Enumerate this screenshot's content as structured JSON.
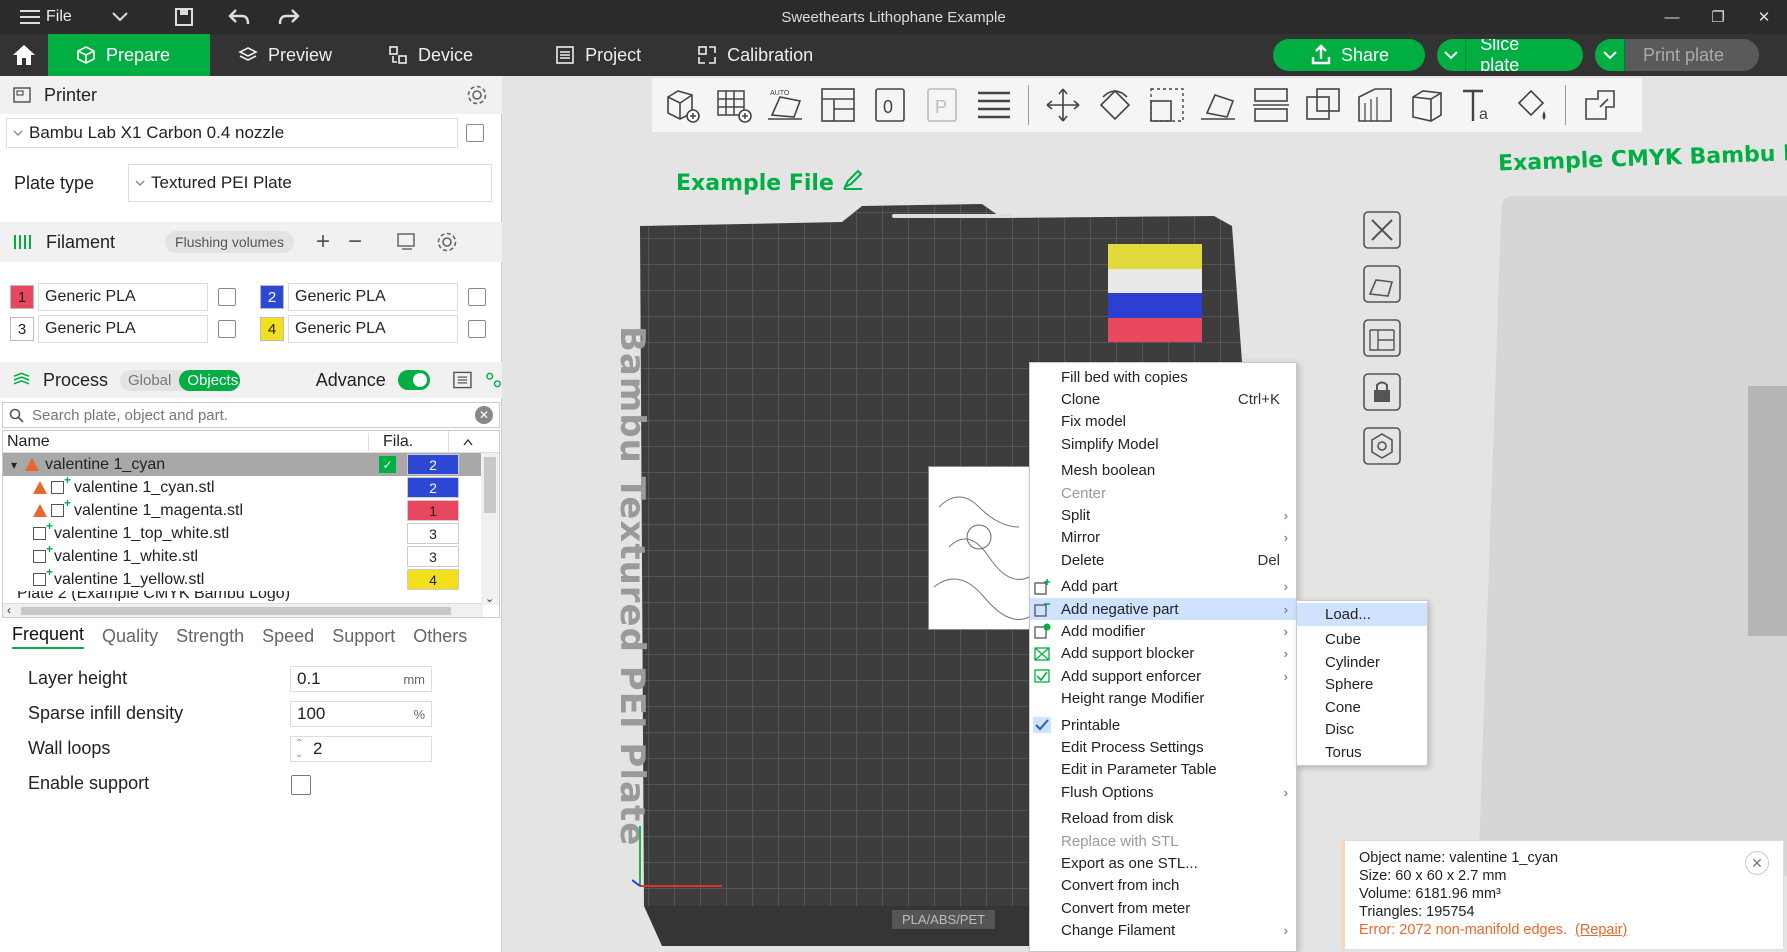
{
  "titlebar": {
    "file_label": "File",
    "window_title": "Sweethearts Lithophane Example"
  },
  "nav": {
    "tabs": [
      {
        "label": "Prepare",
        "icon": "cube-icon"
      },
      {
        "label": "Preview",
        "icon": "layers-icon"
      },
      {
        "label": "Device",
        "icon": "device-icon"
      },
      {
        "label": "Project",
        "icon": "project-icon"
      },
      {
        "label": "Calibration",
        "icon": "calibration-icon"
      }
    ],
    "share_label": "Share",
    "slice_label": "Slice plate",
    "print_label": "Print plate",
    "accent": "#00ae42"
  },
  "printer": {
    "section_label": "Printer",
    "printer_name": "Bambu Lab X1 Carbon 0.4 nozzle",
    "plate_type_label": "Plate type",
    "plate_type_value": "Textured PEI Plate"
  },
  "filament": {
    "section_label": "Filament",
    "flushing_label": "Flushing volumes",
    "items": [
      {
        "index": "1",
        "name": "Generic PLA",
        "color": "#e8485f"
      },
      {
        "index": "2",
        "name": "Generic PLA",
        "color": "#2d48d4"
      },
      {
        "index": "3",
        "name": "Generic PLA",
        "color": "#ffffff"
      },
      {
        "index": "4",
        "name": "Generic PLA",
        "color": "#f2e01f"
      }
    ]
  },
  "process": {
    "section_label": "Process",
    "global_label": "Global",
    "objects_label": "Objects",
    "advance_label": "Advance",
    "search_placeholder": "Search plate, object and part.",
    "col_name": "Name",
    "col_fila": "Fila.",
    "tree": [
      {
        "name": "valentine 1_cyan",
        "fila": "2",
        "color": "#2d48d4"
      },
      {
        "name": "valentine 1_cyan.stl",
        "fila": "2",
        "color": "#2d48d4"
      },
      {
        "name": "valentine 1_magenta.stl",
        "fila": "1",
        "color": "#e8485f"
      },
      {
        "name": "valentine 1_top_white.stl",
        "fila": "3",
        "color": "#ffffff"
      },
      {
        "name": "valentine 1_white.stl",
        "fila": "3",
        "color": "#ffffff"
      },
      {
        "name": "valentine 1_yellow.stl",
        "fila": "4",
        "color": "#f2e01f"
      },
      {
        "name": "Plate 2 (Example CMYK Bambu Logo)",
        "fila": "",
        "color": ""
      }
    ],
    "tabs": [
      "Frequent",
      "Quality",
      "Strength",
      "Speed",
      "Support",
      "Others"
    ],
    "params": [
      {
        "label": "Layer height",
        "value": "0.1",
        "unit": "mm"
      },
      {
        "label": "Sparse infill density",
        "value": "100",
        "unit": "%"
      },
      {
        "label": "Wall loops",
        "value": "2",
        "unit": ""
      },
      {
        "label": "Enable support",
        "value": "",
        "unit": ""
      }
    ]
  },
  "canvas": {
    "plate1_label": "Example File",
    "plate2_label": "Example CMYK Bambu Lo",
    "bed_text": "Bambu Textured PEI Plate",
    "bed_footer": "PLA/ABS/PET"
  },
  "context_menu": {
    "items": [
      {
        "label": "Fill bed with copies",
        "acc": ""
      },
      {
        "label": "Clone",
        "acc": "Ctrl+K"
      },
      {
        "label": "Fix model",
        "acc": ""
      },
      {
        "label": "Simplify Model",
        "acc": ""
      },
      {
        "label": "Mesh boolean",
        "acc": ""
      },
      {
        "label": "Center",
        "acc": ""
      },
      {
        "label": "Split",
        "acc": ""
      },
      {
        "label": "Mirror",
        "acc": ""
      },
      {
        "label": "Delete",
        "acc": "Del"
      },
      {
        "label": "Add part",
        "acc": ""
      },
      {
        "label": "Add negative part",
        "acc": ""
      },
      {
        "label": "Add modifier",
        "acc": ""
      },
      {
        "label": "Add support blocker",
        "acc": ""
      },
      {
        "label": "Add support enforcer",
        "acc": ""
      },
      {
        "label": "Height range Modifier",
        "acc": ""
      },
      {
        "label": "Printable",
        "acc": ""
      },
      {
        "label": "Edit Process Settings",
        "acc": ""
      },
      {
        "label": "Edit in Parameter Table",
        "acc": ""
      },
      {
        "label": "Flush Options",
        "acc": ""
      },
      {
        "label": "Reload from disk",
        "acc": ""
      },
      {
        "label": "Replace with STL",
        "acc": ""
      },
      {
        "label": "Export as one STL...",
        "acc": ""
      },
      {
        "label": "Convert from inch",
        "acc": ""
      },
      {
        "label": "Convert from meter",
        "acc": ""
      },
      {
        "label": "Change Filament",
        "acc": ""
      }
    ],
    "submenu": [
      "Load...",
      "Cube",
      "Cylinder",
      "Sphere",
      "Cone",
      "Disc",
      "Torus"
    ]
  },
  "info": {
    "object_name": "Object name: valentine 1_cyan",
    "size": "Size: 60 x 60 x 2.7 mm",
    "volume": "Volume: 6181.96 mm³",
    "triangles": "Triangles: 195754",
    "error": "Error: 2072 non-manifold edges.",
    "repair": "(Repair)"
  }
}
